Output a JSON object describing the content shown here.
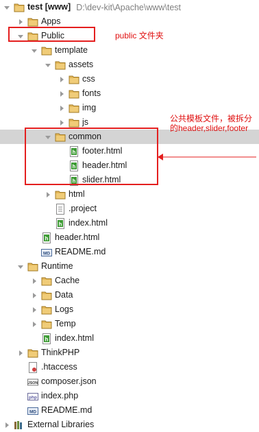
{
  "tree": [
    {
      "name": "test-folder",
      "label": "test [www]",
      "bold": true,
      "path": "D:\\dev-kit\\Apache\\www\\test",
      "depth": 0,
      "expanded": true,
      "icon": "folder"
    },
    {
      "name": "apps-folder",
      "label": "Apps",
      "depth": 1,
      "expanded": false,
      "icon": "folder"
    },
    {
      "name": "public-folder",
      "label": "Public",
      "depth": 1,
      "expanded": true,
      "icon": "folder"
    },
    {
      "name": "template-folder",
      "label": "template",
      "depth": 2,
      "expanded": true,
      "icon": "folder"
    },
    {
      "name": "assets-folder",
      "label": "assets",
      "depth": 3,
      "expanded": true,
      "icon": "folder"
    },
    {
      "name": "css-folder",
      "label": "css",
      "depth": 4,
      "expanded": false,
      "icon": "folder"
    },
    {
      "name": "fonts-folder",
      "label": "fonts",
      "depth": 4,
      "expanded": false,
      "icon": "folder"
    },
    {
      "name": "img-folder",
      "label": "img",
      "depth": 4,
      "expanded": false,
      "icon": "folder"
    },
    {
      "name": "js-folder",
      "label": "js",
      "depth": 4,
      "expanded": false,
      "icon": "folder"
    },
    {
      "name": "common-folder",
      "label": "common",
      "depth": 3,
      "expanded": true,
      "icon": "folder",
      "selected": true
    },
    {
      "name": "footer-html-file",
      "label": "footer.html",
      "depth": 4,
      "icon": "html"
    },
    {
      "name": "header-html-file-common",
      "label": "header.html",
      "depth": 4,
      "icon": "html"
    },
    {
      "name": "slider-html-file",
      "label": "slider.html",
      "depth": 4,
      "icon": "html"
    },
    {
      "name": "html-folder",
      "label": "html",
      "depth": 3,
      "expanded": false,
      "icon": "folder"
    },
    {
      "name": "project-file",
      "label": ".project",
      "depth": 3,
      "icon": "text"
    },
    {
      "name": "index-html-file-template",
      "label": "index.html",
      "depth": 3,
      "icon": "html"
    },
    {
      "name": "header-html-file-public",
      "label": "header.html",
      "depth": 2,
      "icon": "html"
    },
    {
      "name": "readme-file-public",
      "label": "README.md",
      "depth": 2,
      "icon": "md"
    },
    {
      "name": "runtime-folder",
      "label": "Runtime",
      "depth": 1,
      "expanded": true,
      "icon": "folder"
    },
    {
      "name": "cache-folder",
      "label": "Cache",
      "depth": 2,
      "expanded": false,
      "icon": "folder"
    },
    {
      "name": "data-folder",
      "label": "Data",
      "depth": 2,
      "expanded": false,
      "icon": "folder"
    },
    {
      "name": "logs-folder",
      "label": "Logs",
      "depth": 2,
      "expanded": false,
      "icon": "folder"
    },
    {
      "name": "temp-folder",
      "label": "Temp",
      "depth": 2,
      "expanded": false,
      "icon": "folder"
    },
    {
      "name": "index-html-file-runtime",
      "label": "index.html",
      "depth": 2,
      "icon": "html"
    },
    {
      "name": "thinkphp-folder",
      "label": "ThinkPHP",
      "depth": 1,
      "expanded": false,
      "icon": "folder"
    },
    {
      "name": "htaccess-file",
      "label": ".htaccess",
      "depth": 1,
      "icon": "htaccess"
    },
    {
      "name": "composer-json-file",
      "label": "composer.json",
      "depth": 1,
      "icon": "json"
    },
    {
      "name": "index-php-file",
      "label": "index.php",
      "depth": 1,
      "icon": "php"
    },
    {
      "name": "readme-file-root",
      "label": "README.md",
      "depth": 1,
      "icon": "md"
    },
    {
      "name": "external-libraries",
      "label": "External Libraries",
      "depth": 0,
      "expanded": false,
      "icon": "library"
    }
  ],
  "annotations": {
    "public_note": "public 文件夹",
    "common_note_line1": "公共模板文件，被拆分",
    "common_note_line2": "的header,slider,footer"
  },
  "colors": {
    "annotation_red": "#e41e1e",
    "selection_gray": "#d4d4d4",
    "folder": "#e3b759",
    "html_green": "#3d9b34"
  }
}
